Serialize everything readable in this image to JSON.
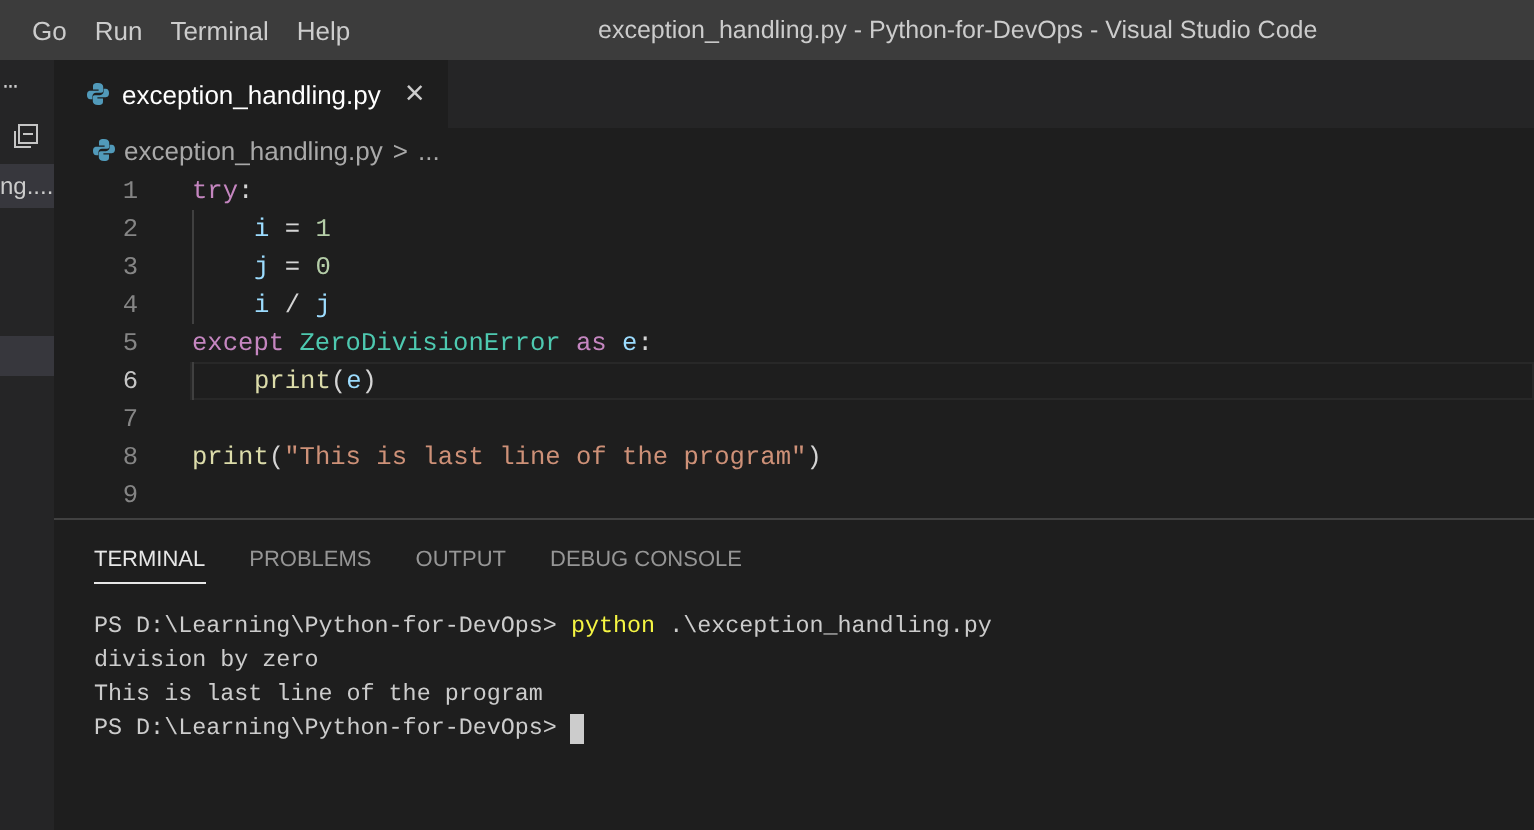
{
  "menu": [
    "Go",
    "Run",
    "Terminal",
    "Help"
  ],
  "window": {
    "title": "exception_handling.py - Python-for-DevOps - Visual Studio Code"
  },
  "sidebar": {
    "more": "···",
    "items": [
      {
        "label": "ng....",
        "selected": true
      }
    ]
  },
  "tabs": [
    {
      "label": "exception_handling.py",
      "selected": true,
      "close": "×"
    }
  ],
  "breadcrumb": {
    "file": "exception_handling.py",
    "separator": ">",
    "rest": "..."
  },
  "code": [
    {
      "number": "1",
      "indent": false,
      "current": false,
      "tokens": [
        {
          "kind": "keyword",
          "text": "try"
        },
        {
          "kind": "plain",
          "text": ":"
        }
      ]
    },
    {
      "number": "2",
      "indent": true,
      "current": false,
      "tokens": [
        {
          "kind": "variable",
          "text": "i"
        },
        {
          "kind": "plain",
          "text": " = "
        },
        {
          "kind": "number",
          "text": "1"
        }
      ]
    },
    {
      "number": "3",
      "indent": true,
      "current": false,
      "tokens": [
        {
          "kind": "variable",
          "text": "j"
        },
        {
          "kind": "plain",
          "text": " = "
        },
        {
          "kind": "number",
          "text": "0"
        }
      ]
    },
    {
      "number": "4",
      "indent": true,
      "current": false,
      "tokens": [
        {
          "kind": "variable",
          "text": "i"
        },
        {
          "kind": "plain",
          "text": " / "
        },
        {
          "kind": "variable",
          "text": "j"
        }
      ]
    },
    {
      "number": "5",
      "indent": false,
      "current": false,
      "tokens": [
        {
          "kind": "keyword",
          "text": "except"
        },
        {
          "kind": "class",
          "text": "ZeroDivisionError",
          "space_before": true
        },
        {
          "kind": "keyword",
          "text": "as",
          "space_before": true
        },
        {
          "kind": "variable",
          "text": "e",
          "space_before": true
        },
        {
          "kind": "plain",
          "text": ":"
        }
      ]
    },
    {
      "number": "6",
      "indent": true,
      "current": true,
      "tokens": [
        {
          "kind": "function",
          "text": "print"
        },
        {
          "kind": "plain",
          "text": "("
        },
        {
          "kind": "variable",
          "text": "e"
        },
        {
          "kind": "plain",
          "text": ")"
        }
      ]
    },
    {
      "number": "7",
      "indent": false,
      "current": false
    },
    {
      "number": "8",
      "indent": false,
      "current": false,
      "tokens": [
        {
          "kind": "function",
          "text": "print"
        },
        {
          "kind": "plain",
          "text": "("
        },
        {
          "kind": "string",
          "text": "\"This is last line of the program\""
        },
        {
          "kind": "plain",
          "text": ")"
        }
      ]
    },
    {
      "number": "9",
      "indent": false,
      "current": false
    }
  ],
  "panel_tabs": [
    {
      "label": "TERMINAL",
      "selected": true
    },
    {
      "label": "PROBLEMS",
      "selected": false
    },
    {
      "label": "OUTPUT",
      "selected": false
    },
    {
      "label": "DEBUG CONSOLE",
      "selected": false
    }
  ],
  "terminal": [
    {
      "tokens": [
        {
          "kind": "plain",
          "text": "PS D:\\Learning\\Python-for-DevOps> "
        },
        {
          "kind": "command",
          "text": "python"
        },
        {
          "kind": "plain",
          "text": " .\\exception_handling.py"
        }
      ],
      "cursor": false
    },
    {
      "tokens": [
        {
          "kind": "plain",
          "text": "division by zero"
        }
      ],
      "cursor": false
    },
    {
      "tokens": [
        {
          "kind": "plain",
          "text": "This is last line of the program"
        }
      ],
      "cursor": false
    },
    {
      "tokens": [
        {
          "kind": "plain",
          "text": "PS D:\\Learning\\Python-for-DevOps> "
        }
      ],
      "cursor": true
    }
  ]
}
